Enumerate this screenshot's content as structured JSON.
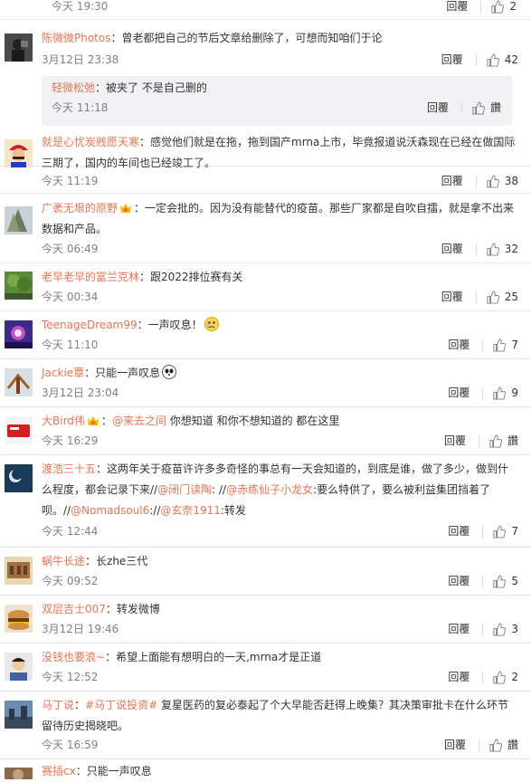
{
  "reply_label": "回覆",
  "like_zero": "讚",
  "comments": {
    "c0": {
      "time": "今天 19:30",
      "likes": "2"
    },
    "c1": {
      "user": "陈微微Photos",
      "text": "：曾老都把自己的节后文章给删除了，可想而知咱们于论",
      "time": "3月12日 23:38",
      "likes": "42"
    },
    "r1": {
      "user": "轻微松弛",
      "text": "：被夹了 不是自己删的",
      "time": "今天 11:18",
      "likes": "讚"
    },
    "c2": {
      "user": "就是心忧炭贱愿天寒",
      "text": "：感觉他们就是在拖，拖到国产mrna上市，毕竟报道说沃森现在已经在做国际三期了，国内的车间也已经竣工了。",
      "time": "今天 11:19",
      "likes": "38"
    },
    "c3": {
      "user": "广袤无垠的原野",
      "text": "：一定会批的。因为没有能替代的疫苗。那些厂家都是自吹自擂，就是拿不出来数据和产品。",
      "time": "今天 06:49",
      "likes": "32"
    },
    "c4": {
      "user": "老早老早的富兰克林",
      "text": "：跟2022排位赛有关",
      "time": "今天 00:34",
      "likes": "25"
    },
    "c5": {
      "user": "TeenageDream99",
      "text": "：一声叹息！",
      "time": "今天 11:10",
      "likes": "7"
    },
    "c6": {
      "user": "Jackie覃",
      "text": "：只能一声叹息",
      "time": "3月12日 23:04",
      "likes": "9"
    },
    "c7": {
      "user": "大Bird伟",
      "text_pre": "：",
      "mention": "@来去之间",
      "text_post": " 你想知道 和你不想知道的 都在这里",
      "time": "今天 16:29",
      "likes": "讚"
    },
    "c8": {
      "user": "渡浩三十五",
      "text_a": "：这两年关于疫苗许许多多奇怪的事总有一天会知道的，到底是谁，做了多少，做到什么程度，都会记录下来//",
      "m1": "@闭门读陶",
      "text_b": ": //",
      "m2": "@赤练仙子小龙女",
      "text_c": ":要么特供了，要么被利益集团挡着了呗。//",
      "m3": "@Nomadsoul6",
      "text_d": "://",
      "m4": "@玄奈1911",
      "text_e": ":转发",
      "time": "今天 12:44",
      "likes": "7"
    },
    "c9": {
      "user": "蜗牛长途",
      "text": "：长zhe三代",
      "time": "今天 09:52",
      "likes": "5"
    },
    "c10": {
      "user": "双层吉士007",
      "text": "：转发微博",
      "time": "3月12日 19:46",
      "likes": "3"
    },
    "c11": {
      "user": "没钱也要浪~",
      "text": "：希望上面能有想明白的一天,mrna才是正道",
      "time": "今天 12:52",
      "likes": "2"
    },
    "c12": {
      "user": "马丁说",
      "text_pre": "：",
      "tag": "#马丁说投资#",
      "text_post": " 复星医药的复必泰起了个大早能否赶得上晚集？其决策审批卡在什么环节留待历史揭晓吧。",
      "time": "今天 16:59",
      "likes": "讚"
    },
    "c13": {
      "user": "赛插cx",
      "text": "：只能一声叹息"
    }
  }
}
